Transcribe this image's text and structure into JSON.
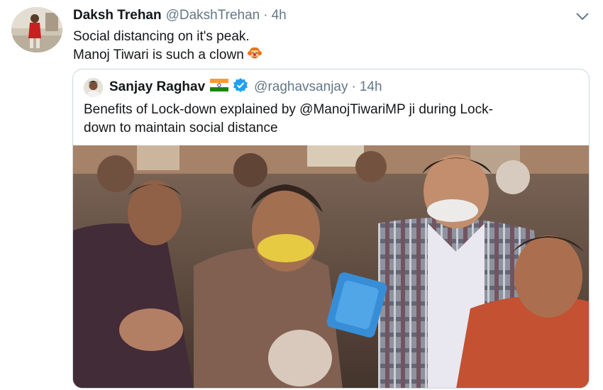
{
  "tweet": {
    "author_name": "Daksh Trehan",
    "author_handle": "@DakshTrehan",
    "separator": "·",
    "time": "4h",
    "text_line1": "Social distancing on it's peak.",
    "text_line2": "Manoj Tiwari is such a clown",
    "emoji": "clown-woman-emoji",
    "menu_icon": "chevron-down-icon"
  },
  "quoted_tweet": {
    "author_name": "Sanjay Raghav",
    "flag": "india-flag-icon",
    "verified_icon": "verified-badge-icon",
    "author_handle": "@raghavsanjay",
    "separator": "·",
    "time": "14h",
    "text_line1": "Benefits of Lock-down explained by @ManojTiwariMP ji during Lock-",
    "text_line2": "down to maintain social distance",
    "media": "crowd-video-thumbnail"
  },
  "colors": {
    "text_primary": "#14171a",
    "text_secondary": "#657786",
    "border": "#ccd6dd",
    "verified_blue": "#1da1f2"
  }
}
